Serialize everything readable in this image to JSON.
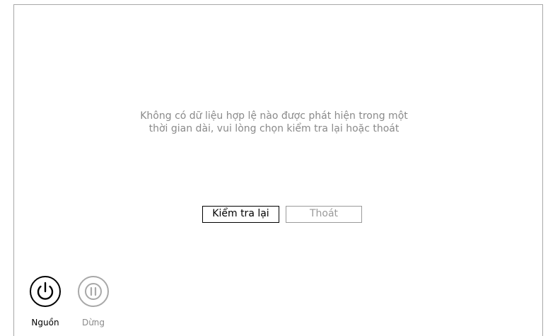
{
  "dialog": {
    "message_line1": "Không có dữ liệu hợp lệ nào được phát hiện trong một",
    "message_line2": "thời gian dài, vui lòng chọn kiểm tra lại hoặc thoát",
    "retry_label": "Kiểm tra lại",
    "exit_label": "Thoát"
  },
  "controls": {
    "power_label": "Nguồn",
    "power_icon": "power-icon",
    "pause_label": "Dừng",
    "pause_icon": "pause-icon"
  },
  "colors": {
    "text_muted": "#8a8a8a",
    "border_active": "#000000",
    "border_disabled": "#9a9a9a"
  }
}
